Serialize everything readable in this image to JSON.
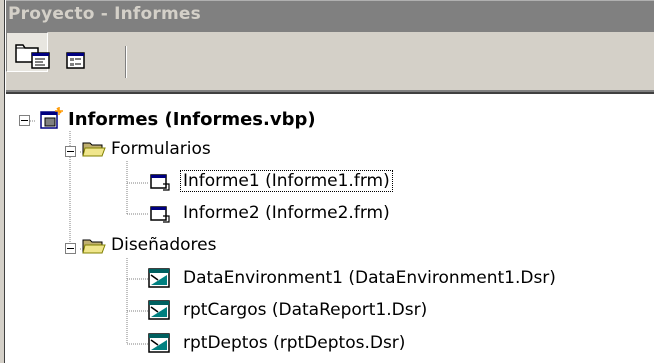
{
  "window": {
    "title": "Proyecto - Informes"
  },
  "toolbar": {
    "buttons": [
      {
        "name": "view-code",
        "icon": "view-code-icon"
      },
      {
        "name": "view-object",
        "icon": "view-object-icon"
      },
      {
        "name": "toggle-folders",
        "icon": "folder-icon",
        "pressed": true
      }
    ]
  },
  "tree": {
    "project": {
      "label": "Informes (Informes.vbp)",
      "icon": "project-icon",
      "expanded": true
    },
    "folders": [
      {
        "label": "Formularios",
        "icon": "folder-open-icon",
        "expanded": true,
        "items": [
          {
            "label": "Informe1 (Informe1.frm)",
            "icon": "form-icon",
            "selected": true
          },
          {
            "label": "Informe2 (Informe2.frm)",
            "icon": "form-icon",
            "selected": false
          }
        ]
      },
      {
        "label": "Diseñadores",
        "icon": "folder-open-icon",
        "expanded": true,
        "items": [
          {
            "label": "DataEnvironment1 (DataEnvironment1.Dsr)",
            "icon": "designer-icon",
            "selected": false
          },
          {
            "label": "rptCargos (DataReport1.Dsr)",
            "icon": "designer-icon",
            "selected": false
          },
          {
            "label": "rptDeptos (rptDeptos.Dsr)",
            "icon": "designer-icon",
            "selected": false
          }
        ]
      }
    ]
  },
  "colors": {
    "titlebar_inactive": "#808080",
    "title_text": "#d4d0c8",
    "face": "#d4d0c8",
    "tree_background": "#ffffff"
  }
}
